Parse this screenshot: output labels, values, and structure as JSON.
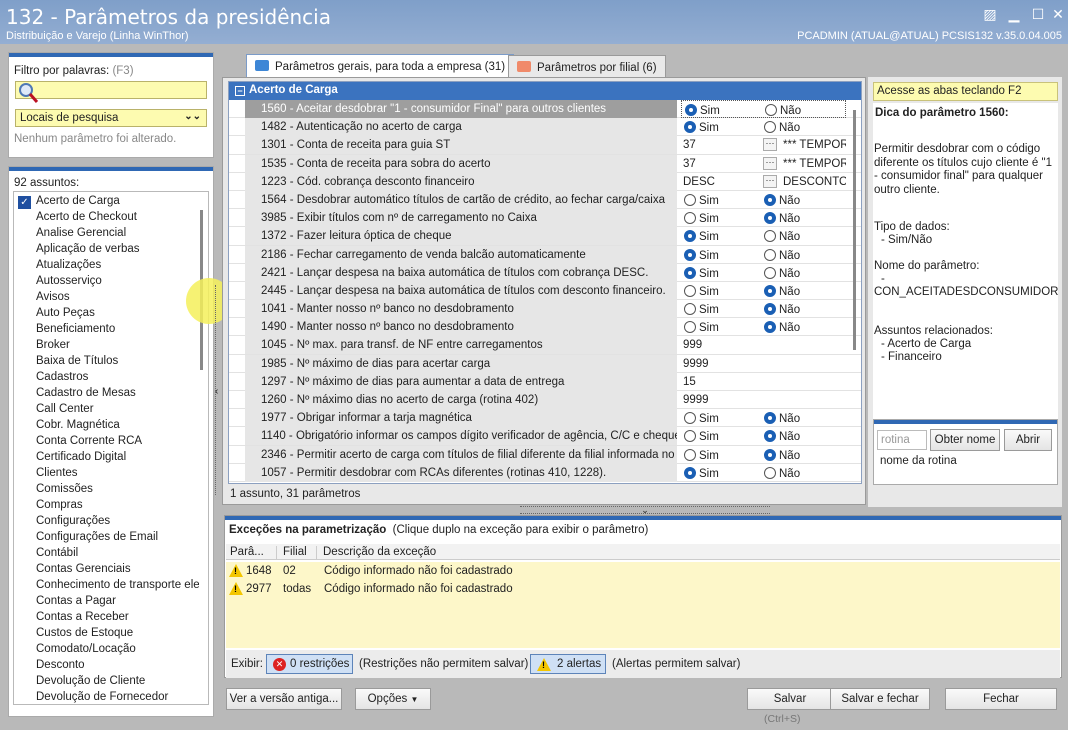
{
  "window": {
    "title": "132 - Parâmetros da presidência",
    "subtitle": "Distribuição e Varejo (Linha WinThor)",
    "user_info": "PCADMIN (ATUAL@ATUAL)   PCSIS132  v.35.0.04.005"
  },
  "filter": {
    "label": "Filtro por palavras:",
    "shortcut": "(F3)",
    "search_value": "",
    "locations_label": "Locais de pesquisa",
    "status": "Nenhum parâmetro foi alterado."
  },
  "subjects": {
    "count_label": "92 assuntos:",
    "items": [
      "Acerto de Carga",
      "Acerto de Checkout",
      "Analise Gerencial",
      "Aplicação de verbas",
      "Atualizações",
      "Autosserviço",
      "Avisos",
      "Auto Peças",
      "Beneficiamento",
      "Broker",
      "Baixa de Títulos",
      "Cadastros",
      "Cadastro de Mesas",
      "Call Center",
      "Cobr. Magnética",
      "Conta Corrente RCA",
      "Certificado Digital",
      "Clientes",
      "Comissões",
      "Compras",
      "Configurações",
      "Configurações de Email",
      "Contábil",
      "Contas Gerenciais",
      "Conhecimento de transporte ele",
      "Contas a Pagar",
      "Contas a Receber",
      "Custos de Estoque",
      "Comodato/Locação",
      "Desconto",
      "Devolução de Cliente",
      "Devolução de Fornecedor"
    ],
    "checked_index": 0
  },
  "tabs": [
    {
      "label": "Parâmetros gerais, para toda a empresa",
      "count": "(31)",
      "color": "#3d86d6"
    },
    {
      "label": "Parâmetros por filial",
      "count": "(6)",
      "color": "#f08a6a"
    }
  ],
  "group": {
    "title": "Acerto de Carga",
    "toggle": "−"
  },
  "params": [
    {
      "label": "1560 - Aceitar desdobrar \"1 - consumidor Final\" para outros clientes",
      "type": "radio",
      "value": "Sim",
      "selected": true
    },
    {
      "label": "1482 - Autenticação no acerto de carga",
      "type": "radio",
      "value": "Sim"
    },
    {
      "label": "1301 - Conta de receita para guia ST",
      "type": "lookup",
      "value": "37",
      "desc": "*** TEMPOR"
    },
    {
      "label": "1535 - Conta de receita para sobra do acerto",
      "type": "lookup",
      "value": "37",
      "desc": "*** TEMPOR"
    },
    {
      "label": "1223 - Cód. cobrança desconto financeiro",
      "type": "lookup",
      "value": "DESC",
      "desc": "DESCONTO ("
    },
    {
      "label": "1564 - Desdobrar automático títulos de cartão de crédito, ao fechar carga/caixa",
      "type": "radio",
      "value": "Não"
    },
    {
      "label": "3985 - Exibir títulos com nº de carregamento no Caixa",
      "type": "radio",
      "value": "Não"
    },
    {
      "label": "1372 - Fazer leitura óptica de cheque",
      "type": "radio",
      "value": "Sim"
    },
    {
      "label": "2186 - Fechar carregamento de venda balcão automaticamente",
      "type": "radio",
      "value": "Sim"
    },
    {
      "label": "2421 - Lançar despesa na baixa automática de títulos com cobrança DESC.",
      "type": "radio",
      "value": "Sim"
    },
    {
      "label": "2445 - Lançar despesa na baixa automática de títulos com desconto financeiro.",
      "type": "radio",
      "value": "Não"
    },
    {
      "label": "1041 - Manter nosso nº banco no desdobramento",
      "type": "radio",
      "value": "Não"
    },
    {
      "label": "1490 - Manter nosso nº banco no desdobramento",
      "type": "radio",
      "value": "Não"
    },
    {
      "label": "1045 - Nº max. para transf. de NF entre carregamentos",
      "type": "text",
      "value": "999"
    },
    {
      "label": "1985 - Nº máximo de dias para acertar carga",
      "type": "text",
      "value": "9999"
    },
    {
      "label": "1297 - Nº máximo de dias para aumentar a data de entrega",
      "type": "text",
      "value": "15"
    },
    {
      "label": "1260 - Nº máximo dias no acerto de carga (rotina 402)",
      "type": "text",
      "value": "9999"
    },
    {
      "label": "1977 - Obrigar informar a tarja magnética",
      "type": "radio",
      "value": "Não"
    },
    {
      "label": "1140 - Obrigatório informar os campos dígito verificador de agência, C/C e cheque obri",
      "type": "radio",
      "value": "Não"
    },
    {
      "label": "2346 - Permitir acerto de carga com títulos de filial diferente da filial informada no filtro",
      "type": "radio",
      "value": "Não"
    },
    {
      "label": "1057 - Permitir desdobrar com RCAs diferentes (rotinas 410, 1228).",
      "type": "radio",
      "value": "Sim"
    }
  ],
  "radio_labels": {
    "yes": "Sim",
    "no": "Não"
  },
  "lookup_button": "···",
  "grid_status": "1 assunto, 31 parâmetros",
  "right_panel": {
    "hint": "Acesse as abas teclando F2",
    "tip_title": "Dica do parâmetro 1560:",
    "tip_text": "Permitir desdobrar com o código diferente os títulos cujo cliente é \"1 - consumidor final\" para qualquer outro cliente.",
    "data_type_label": "Tipo de dados:",
    "data_type_value": "- Sim/Não",
    "name_label": "Nome do parâmetro:",
    "name_dash": "-",
    "name_value": "CON_ACEITADESDCONSUMIDOROUT",
    "related_label": "Assuntos relacionados:",
    "related": [
      "- Acerto de Carga",
      "- Financeiro"
    ]
  },
  "routine": {
    "placeholder": "rotina",
    "get_name_button": "Obter nome",
    "open_button": "Abrir",
    "name_label": "nome da rotina"
  },
  "exceptions": {
    "title": "Exceções na parametrização",
    "hint": "(Clique duplo na exceção para exibir o parâmetro)",
    "columns": [
      "Parâ...",
      "Filial",
      "Descrição da exceção"
    ],
    "rows": [
      {
        "param": "1648",
        "filial": "02",
        "desc": "Código informado não foi cadastrado"
      },
      {
        "param": "2977",
        "filial": "todas",
        "desc": "Código informado não foi cadastrado"
      }
    ]
  },
  "filter_bar": {
    "show_label": "Exibir:",
    "restrictions_button": "0 restrições",
    "restrictions_note": "(Restrições não permitem salvar)",
    "alerts_button": "2 alertas",
    "alerts_note": "(Alertas permitem salvar)"
  },
  "footer": {
    "old_version": "Ver a versão antiga...",
    "options": "Opções",
    "save": "Salvar",
    "save_shortcut": "(Ctrl+S)",
    "save_close": "Salvar e fechar",
    "close": "Fechar"
  }
}
